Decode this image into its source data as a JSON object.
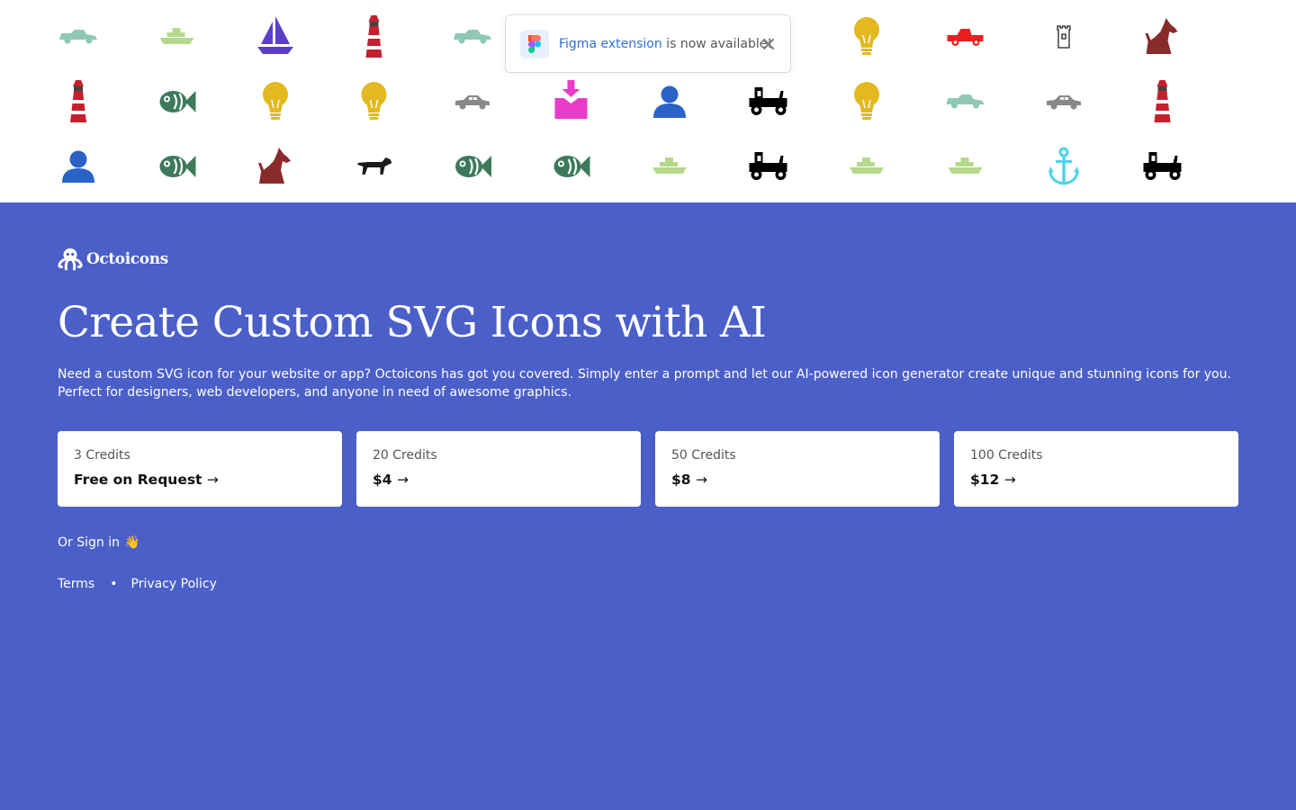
{
  "gallery": {
    "rows": [
      [
        "race-car",
        "boat",
        "sailboat",
        "lighthouse",
        "race-car",
        "",
        "",
        "",
        "lightbulb",
        "pickup-truck",
        "tower",
        "dog-sitting"
      ],
      [
        "lighthouse",
        "fish",
        "lightbulb",
        "lightbulb",
        "car",
        "download-box",
        "user",
        "vintage-car",
        "lightbulb",
        "race-car",
        "car",
        "lighthouse"
      ],
      [
        "user",
        "fish",
        "dog-sitting",
        "dog-running",
        "fish",
        "fish",
        "boat",
        "vintage-car",
        "boat",
        "boat",
        "anchor",
        "vintage-car"
      ]
    ],
    "colors": {
      "race-car": "#8fc8b4",
      "boat": "#b5d98a",
      "sailboat": "#5b3ec9",
      "lighthouse": "#c4202e",
      "lightbulb": "#e3b820",
      "pickup-truck": "#e62020",
      "tower": "#222222",
      "dog-sitting": "#8a2b2b",
      "fish": "#3d7a5c",
      "car": "#888888",
      "download-box": "#e83cc8",
      "user": "#2a62c7",
      "vintage-car": "#000000",
      "dog-running": "#1b1b1b",
      "anchor": "#4cd3ea"
    }
  },
  "notification": {
    "logo_icon": "figma-icon",
    "link_text": "Figma extension",
    "message": " is now available!",
    "close_icon": "close-icon"
  },
  "brand": {
    "name": "Octoicons",
    "logo_icon": "octopus-icon"
  },
  "hero": {
    "title": "Create Custom SVG Icons with AI",
    "description": "Need a custom SVG icon for your website or app? Octoicons has got you covered. Simply enter a prompt and let our AI-powered icon generator create unique and stunning icons for you. Perfect for designers, web developers, and anyone in need of awesome graphics."
  },
  "plans": [
    {
      "credits": "3 Credits",
      "price": "Free on Request"
    },
    {
      "credits": "20 Credits",
      "price": "$4"
    },
    {
      "credits": "50 Credits",
      "price": "$8"
    },
    {
      "credits": "100 Credits",
      "price": "$12"
    }
  ],
  "plan_arrow": "→",
  "signin": {
    "label": "Or Sign in",
    "emoji": "👋"
  },
  "footer": {
    "terms": "Terms",
    "separator": "•",
    "privacy": "Privacy Policy"
  },
  "colors": {
    "hero_bg": "#4b5fc8",
    "link": "#2f6fd6"
  }
}
